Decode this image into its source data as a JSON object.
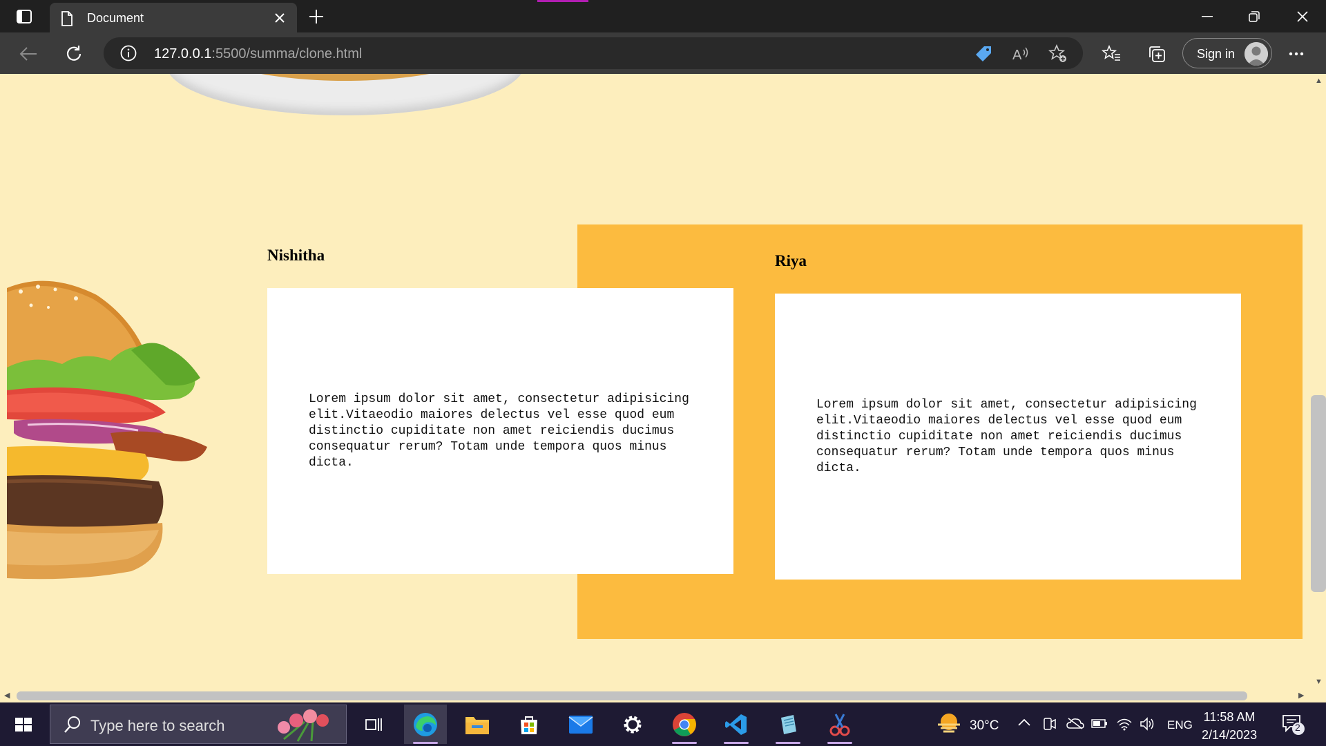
{
  "browser": {
    "tab_title": "Document",
    "url_host": "127.0.0.1",
    "url_rest": ":5500/summa/clone.html",
    "signin_label": "Sign in",
    "accent_color": "#b21eb2"
  },
  "page": {
    "background_color": "#fdeebd",
    "panel_color": "#fcbb3f",
    "testimonials": [
      {
        "name": "Nishitha",
        "text": "Lorem ipsum dolor sit amet, consectetur adipisicing elit.Vitaeodio maiores delectus vel esse quod eum distinctio cupiditate non amet reiciendis ducimus consequatur rerum? Totam unde tempora quos minus dicta."
      },
      {
        "name": "Riya",
        "text": "Lorem ipsum dolor sit amet, consectetur adipisicing elit.Vitaeodio maiores delectus vel esse quod eum distinctio cupiditate non amet reiciendis ducimus consequatur rerum? Totam unde tempora quos minus dicta."
      }
    ]
  },
  "taskbar": {
    "search_placeholder": "Type here to search",
    "temperature": "30°C",
    "language": "ENG",
    "time": "11:58 AM",
    "date": "2/14/2023",
    "notification_count": "2",
    "apps": [
      "task-view",
      "edge",
      "file-explorer",
      "microsoft-store",
      "mail",
      "settings",
      "chrome",
      "vscode",
      "notepad",
      "snipping-tool"
    ]
  }
}
